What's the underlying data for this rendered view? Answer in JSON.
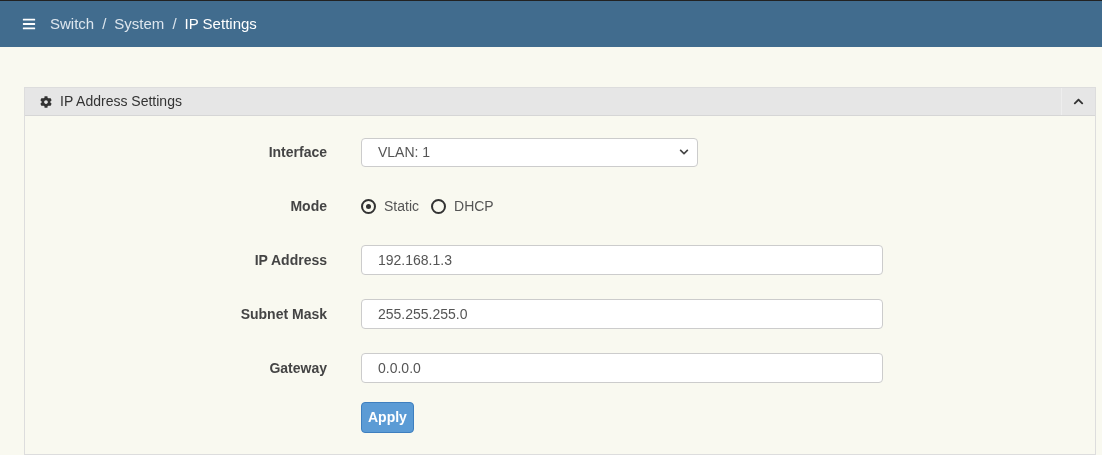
{
  "breadcrumb": [
    "Switch",
    "System",
    "IP Settings"
  ],
  "breadcrumb_separator": "/",
  "panel": {
    "title": "IP Address Settings",
    "expanded": true,
    "fields": [
      {
        "kind": "select",
        "label": "Interface",
        "value": "VLAN: 1"
      },
      {
        "kind": "radio",
        "label": "Mode",
        "options": [
          {
            "label": "Static",
            "selected": true
          },
          {
            "label": "DHCP",
            "selected": false
          }
        ]
      },
      {
        "kind": "text",
        "label": "IP Address",
        "value": "192.168.1.3"
      },
      {
        "kind": "text",
        "label": "Subnet Mask",
        "value": "255.255.255.0"
      },
      {
        "kind": "text",
        "label": "Gateway",
        "value": "0.0.0.0"
      }
    ],
    "button": "Apply"
  }
}
